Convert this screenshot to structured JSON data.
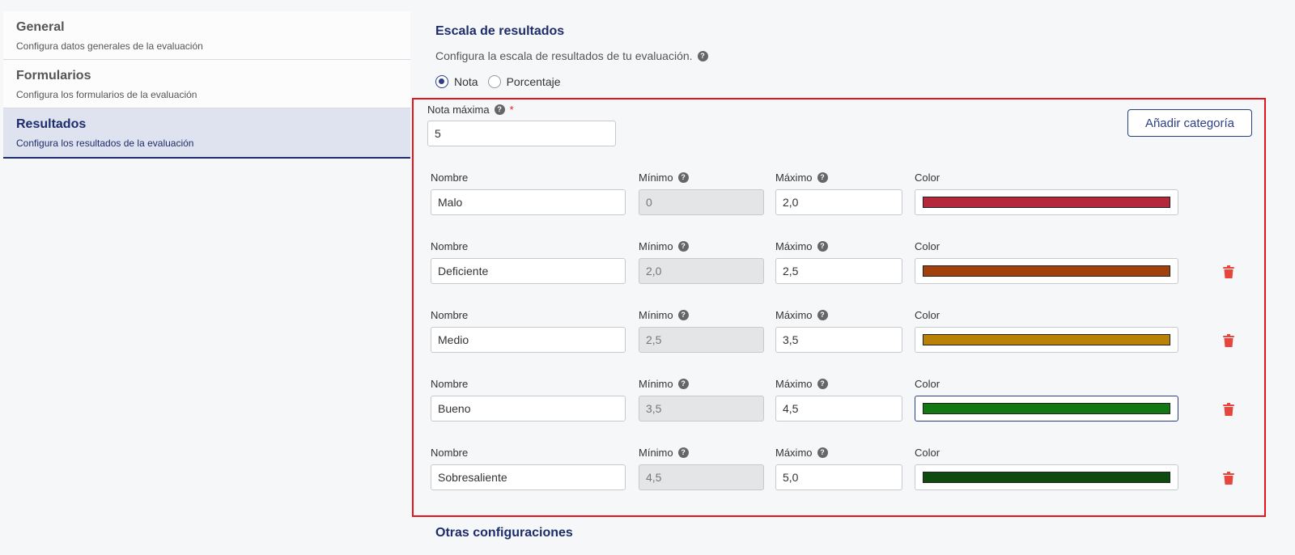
{
  "sidebar": {
    "items": [
      {
        "title": "General",
        "subtitle": "Configura datos generales de la evaluación",
        "active": false
      },
      {
        "title": "Formularios",
        "subtitle": "Configura los formularios de la evaluación",
        "active": false
      },
      {
        "title": "Resultados",
        "subtitle": "Configura los resultados de la evaluación",
        "active": true
      }
    ]
  },
  "section": {
    "title": "Escala de resultados",
    "description": "Configura la escala de resultados de tu evaluación.",
    "help_glyph": "?"
  },
  "scale_type": {
    "options": [
      {
        "label": "Nota",
        "checked": true
      },
      {
        "label": "Porcentaje",
        "checked": false
      }
    ]
  },
  "max_grade": {
    "label": "Nota máxima",
    "required_mark": "*",
    "value": "5"
  },
  "add_category_label": "Añadir categoría",
  "columns": {
    "name": "Nombre",
    "min": "Mínimo",
    "max": "Máximo",
    "color": "Color"
  },
  "categories": [
    {
      "name": "Malo",
      "min": "0",
      "max": "2,0",
      "color": "#b5273b",
      "deletable": false
    },
    {
      "name": "Deficiente",
      "min": "2,0",
      "max": "2,5",
      "color": "#a1400b",
      "deletable": true
    },
    {
      "name": "Medio",
      "min": "2,5",
      "max": "3,5",
      "color": "#b98106",
      "deletable": true
    },
    {
      "name": "Bueno",
      "min": "3,5",
      "max": "4,5",
      "color": "#127912",
      "deletable": true
    },
    {
      "name": "Sobresaliente",
      "min": "4,5",
      "max": "5,0",
      "color": "#0f4a0f",
      "deletable": true
    }
  ],
  "other_settings_title": "Otras configuraciones",
  "colors": {
    "accent": "#1d2d6b",
    "highlight_border": "#e8141c",
    "delete": "#e8453c"
  }
}
